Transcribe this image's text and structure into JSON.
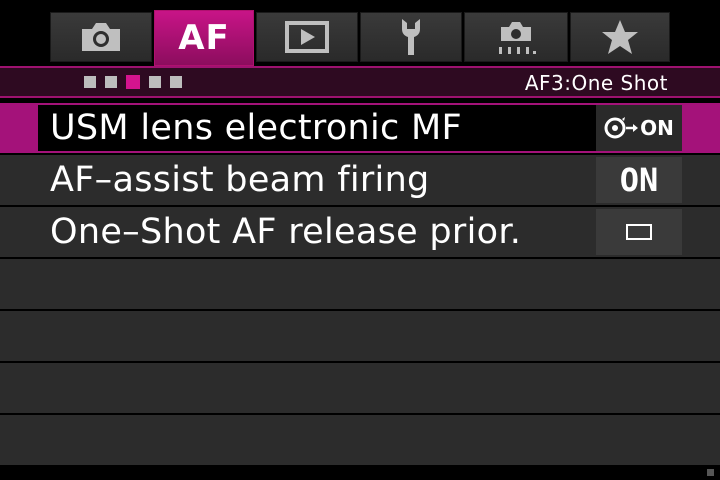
{
  "tabs": [
    {
      "icon": "camera-icon",
      "label": ""
    },
    {
      "icon": "",
      "label": "AF"
    },
    {
      "icon": "playback-icon",
      "label": ""
    },
    {
      "icon": "wrench-icon",
      "label": ""
    },
    {
      "icon": "custom-camera-icon",
      "label": ""
    },
    {
      "icon": "star-icon",
      "label": ""
    }
  ],
  "active_tab": 1,
  "subheader": {
    "pages_total": 5,
    "current_page": 3,
    "title": "AF3:One Shot"
  },
  "menu": {
    "items": [
      {
        "label": "USM lens electronic MF",
        "value": "ON",
        "value_icon": "lens-focus-arrow-icon"
      },
      {
        "label": "AF–assist beam firing",
        "value": "ON",
        "value_icon": ""
      },
      {
        "label": "One–Shot AF release prior.",
        "value": "",
        "value_icon": "focus-frame-icon"
      }
    ],
    "selected_index": 0
  },
  "colors": {
    "accent": "#c81487",
    "background": "#000000",
    "row": "#2c2c2c"
  }
}
